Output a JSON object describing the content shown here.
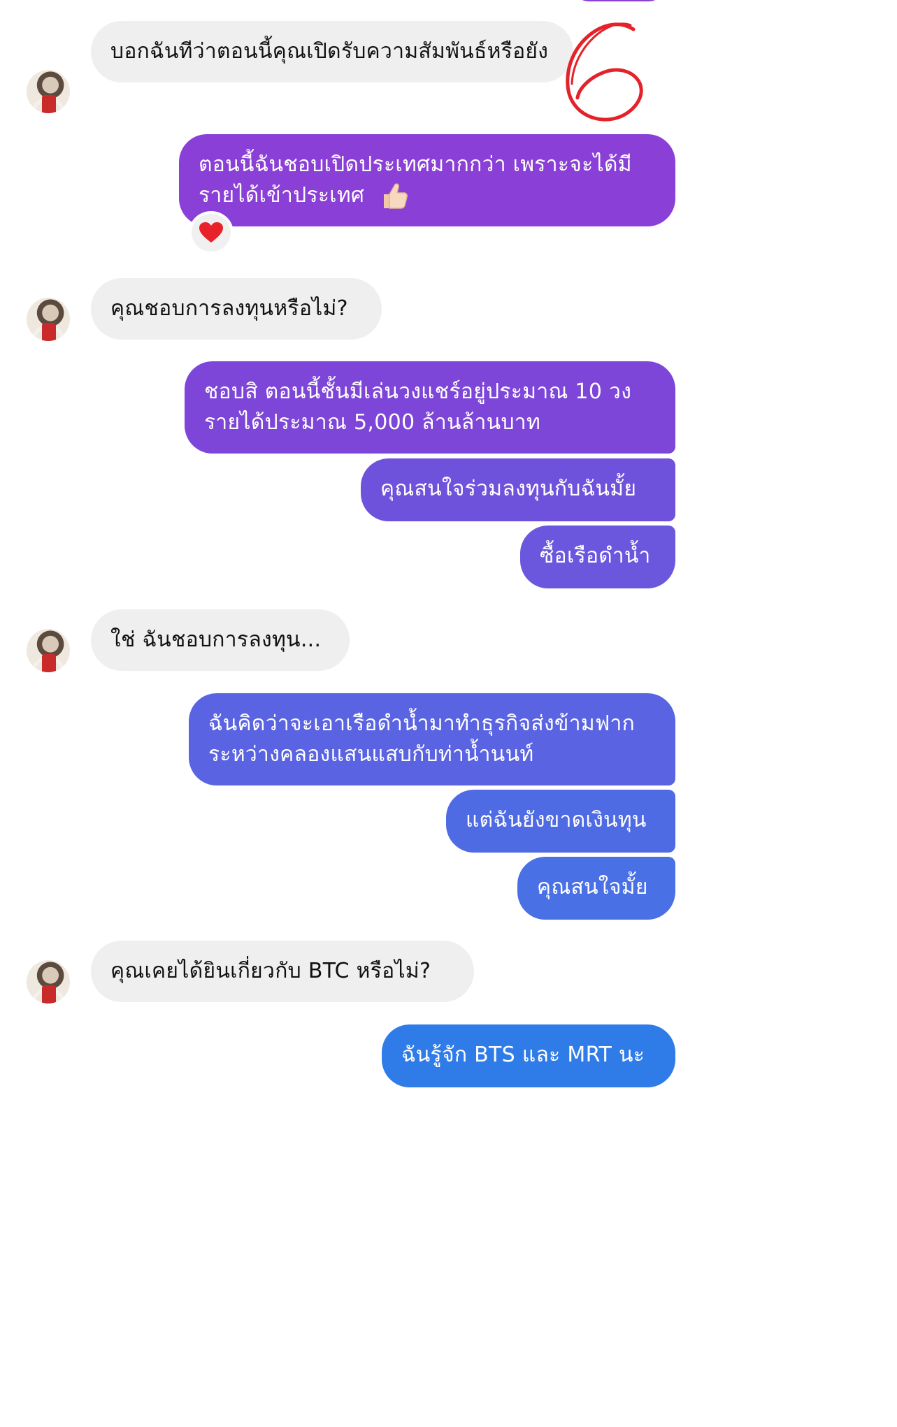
{
  "messages": [
    {
      "side": "in",
      "text": "บอกฉันทีว่าตอนนี้คุณเปิดรับความสัมพันธ์หรือยัง"
    },
    {
      "side": "out",
      "text": "ตอนนี้ฉันชอบเปิดประเทศมากกว่า เพราะจะได้มีรายได้เข้าประเทศ",
      "emoji": "thumbs-up",
      "reaction": "heart"
    },
    {
      "side": "in",
      "text": "คุณชอบการลงทุนหรือไม่?"
    },
    {
      "side": "out",
      "text": "ชอบสิ ตอนนี้ชั้นมีเล่นวงแชร์อยู่ประมาณ 10 วง รายได้ประมาณ 5,000 ล้านล้านบาท"
    },
    {
      "side": "out",
      "text": "คุณสนใจร่วมลงทุนกับฉันมั้ย"
    },
    {
      "side": "out",
      "text": "ซื้อเรือดำน้ำ"
    },
    {
      "side": "in",
      "text": "ใช่ ฉันชอบการลงทุน..."
    },
    {
      "side": "out",
      "text": "ฉันคิดว่าจะเอาเรือดำน้ำมาทำธุรกิจส่งข้ามฟากระหว่างคลองแสนแสบกับท่าน้ำนนท์"
    },
    {
      "side": "out",
      "text": "แต่ฉันยังขาดเงินทุน"
    },
    {
      "side": "out",
      "text": "คุณสนใจมั้ย"
    },
    {
      "side": "in",
      "text": "คุณเคยได้ยินเกี่ยวกับ BTC หรือไม่?"
    },
    {
      "side": "out",
      "text": "ฉันรู้จัก BTS และ MRT นะ"
    }
  ],
  "colors": {
    "incoming_bubble": "#efefef",
    "gradient_top": "#8a3fd6",
    "gradient_mid": "#6a55de",
    "gradient_bottom": "#2f7be8",
    "annotation": "#e3222a"
  }
}
